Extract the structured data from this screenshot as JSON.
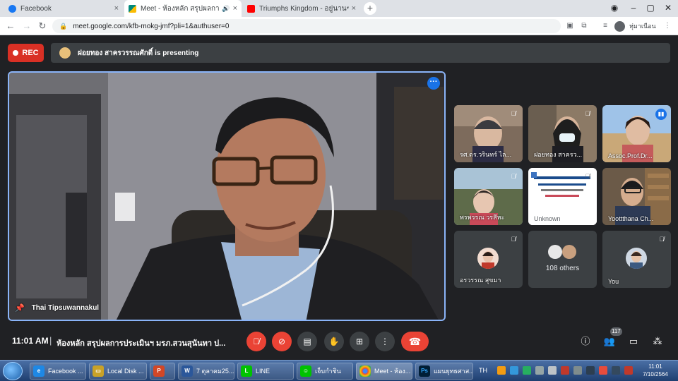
{
  "browser": {
    "tabs": [
      {
        "title": "Facebook",
        "favicon_color": "#1877f2",
        "active": false
      },
      {
        "title": "Meet - ห้องหลัก สรุปผลการประ",
        "favicon_color": "#00897b",
        "active": true
      },
      {
        "title": "Triumphs Kingdom - อยู่นานๆ อีก",
        "favicon_color": "#ff0000",
        "active": false
      }
    ],
    "new_tab": "+",
    "close_glyph": "×",
    "url": "meet.google.com/kfb-mokg-jmf?pli=1&authuser=0",
    "profile_label": "หุ่มาเนือน"
  },
  "meet": {
    "rec_label": "REC",
    "presenting_text": "ฝอยทอง สาครวรรณศักดิ์ is presenting",
    "main_speaker": "Thai Tipsuwannakul",
    "tiles": [
      {
        "name": "รศ.ดร.วรินทร์ ไล...",
        "muted": true
      },
      {
        "name": "ฝอยทอง สาครว...",
        "muted": true
      },
      {
        "name": "Assoc.Prof.Dr...",
        "speaking": true
      },
      {
        "name": "พรพรรณ วรสีหะ",
        "muted": true
      },
      {
        "name": "Unknown",
        "muted": true
      },
      {
        "name": "Yoottthana Ch...",
        "muted": false
      },
      {
        "name": "อรวรรณ สุขมา",
        "muted": true
      },
      {
        "name": "108 others"
      },
      {
        "name": "You",
        "muted": true
      }
    ],
    "clock": "11:01 AM",
    "separator": "|",
    "meeting_title": "ห้องหลัก สรุปผลการประเมินฯ มรภ.สวนสุนันทา ป...",
    "participants_count": "117"
  },
  "taskbar": {
    "items": [
      {
        "label": "Facebook ...",
        "icon_color": "#1e88e5",
        "icon_text": "e"
      },
      {
        "label": "Local Disk ...",
        "icon_color": "#c9a227",
        "icon_text": "▭"
      },
      {
        "label": "",
        "icon_color": "#d24726",
        "icon_text": "P"
      },
      {
        "label": "7 ตุลาคม25...",
        "icon_color": "#2b579a",
        "icon_text": "W"
      },
      {
        "label": "LINE",
        "icon_color": "#00c300",
        "icon_text": "L"
      },
      {
        "label": "เจ็บกำชิน",
        "icon_color": "#00c300",
        "icon_text": "☺"
      },
      {
        "label": "Meet - ห้อง...",
        "icon_color": "#ffffff",
        "icon_text": "◉"
      },
      {
        "label": "แผนยุทธศาส...",
        "icon_color": "#001e36",
        "icon_text": "Ps"
      }
    ],
    "lang": "TH",
    "time": "11:01",
    "date": "7/10/2564"
  }
}
